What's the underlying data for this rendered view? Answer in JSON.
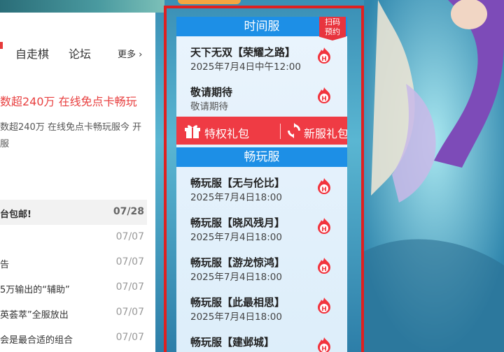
{
  "nav": {
    "items": [
      "自走棋",
      "论坛"
    ],
    "more": "更多 ›"
  },
  "headline": "数超240万 在线免点卡畅玩",
  "summary": "数超240万 在线免点卡畅玩服今 开服",
  "news": [
    {
      "title": "台包邮!",
      "date": "07/28"
    },
    {
      "title": "",
      "date": "07/07"
    },
    {
      "title": "告",
      "date": "07/07"
    },
    {
      "title": "5万输出的“辅助”",
      "date": "07/07"
    },
    {
      "title": "英荟萃”全服放出",
      "date": "07/07"
    },
    {
      "title": "会是最合适的组合",
      "date": "07/07"
    }
  ],
  "time_server": {
    "title": "时间服",
    "badge_line1": "扫码",
    "badge_line2": "预约",
    "items": [
      {
        "name": "天下无双【荣耀之路】",
        "time": "2025年7月4日中午12:00"
      },
      {
        "name": "敬请期待",
        "time": "敬请期待"
      }
    ]
  },
  "gifts": {
    "privilege": "特权礼包",
    "new_server": "新服礼包"
  },
  "play_server": {
    "title": "畅玩服",
    "items": [
      {
        "name": "畅玩服【无与伦比】",
        "time": "2025年7月4日18:00"
      },
      {
        "name": "畅玩服【晓风残月】",
        "time": "2025年7月4日18:00"
      },
      {
        "name": "畅玩服【游龙惊鸿】",
        "time": "2025年7月4日18:00"
      },
      {
        "name": "畅玩服【此最相思】",
        "time": "2025年7月4日18:00"
      },
      {
        "name": "畅玩服【建邺城】",
        "time": ""
      }
    ]
  },
  "icons": {
    "hot": "fire-h-icon",
    "gift": "gift-icon",
    "refresh": "refresh-icon"
  },
  "colors": {
    "accent_blue": "#1d8fe6",
    "accent_red": "#ef3b44",
    "frame_red": "#e02020"
  }
}
